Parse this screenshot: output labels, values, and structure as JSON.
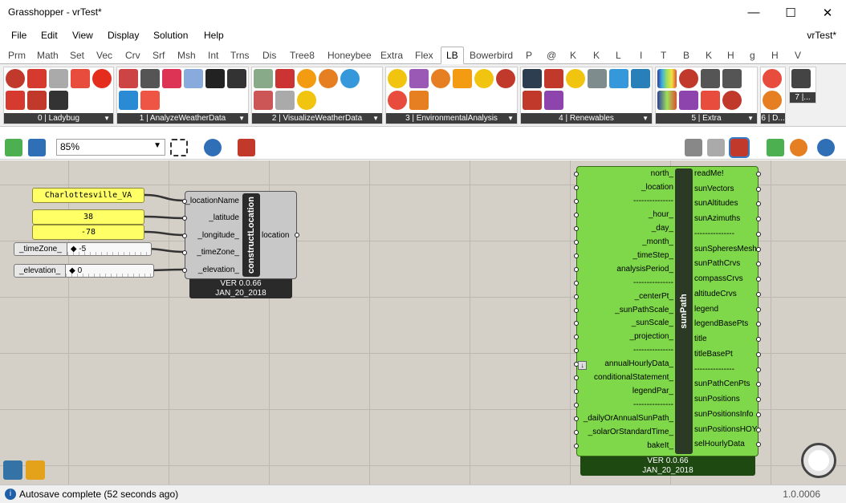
{
  "window": {
    "title": "Grasshopper - vrTest*",
    "doc_title": "vrTest*",
    "minimize": "—",
    "maximize": "☐",
    "close": "✕"
  },
  "menu": [
    "File",
    "Edit",
    "View",
    "Display",
    "Solution",
    "Help"
  ],
  "tabs": [
    "Prm",
    "Math",
    "Set",
    "Vec",
    "Crv",
    "Srf",
    "Msh",
    "Int",
    "Trns",
    "Dis",
    "Tree8",
    "Honeybee",
    "Extra",
    "Flex",
    "LB",
    "Bowerbird",
    "P",
    "@",
    "K",
    "K",
    "L",
    "I",
    "T",
    "B",
    "K",
    "H",
    "g",
    "H",
    "V"
  ],
  "active_tab": "LB",
  "ribbon_groups": [
    {
      "label": "0 | Ladybug"
    },
    {
      "label": "1 | AnalyzeWeatherData"
    },
    {
      "label": "2 | VisualizeWeatherData"
    },
    {
      "label": "3 | EnvironmentalAnalysis"
    },
    {
      "label": "4 | Renewables"
    },
    {
      "label": "5 | Extra"
    },
    {
      "label": "6 | D..."
    }
  ],
  "ribbon_extra_label": "7 |...",
  "canvas_toolbar": {
    "zoom": "85%"
  },
  "canvas": {
    "panels": {
      "location_name": "Charlottesville_VA",
      "latitude": "38",
      "longitude": "-78"
    },
    "sliders": {
      "timezone": {
        "label": "_timeZone_",
        "value": "-5"
      },
      "elevation": {
        "label": "_elevation_",
        "value": "0"
      }
    },
    "construct_location": {
      "name": "constructLocation",
      "inputs": [
        "_locationName",
        "_latitude",
        "_longitude_",
        "_timeZone_",
        "_elevation_"
      ],
      "output": "location",
      "version": "VER 0.0.66",
      "date": "JAN_20_2018"
    },
    "sunpath": {
      "name": "sunPath",
      "inputs": [
        "north_",
        "_location",
        "---------------",
        "_hour_",
        "_day_",
        "_month_",
        "_timeStep_",
        "analysisPeriod_",
        "---------------",
        "_centerPt_",
        "_sunPathScale_",
        "_sunScale_",
        "_projection_",
        "---------------",
        "annualHourlyData_",
        "conditionalStatement_",
        "legendPar_",
        "---------------",
        "_dailyOrAnnualSunPath_",
        "_solarOrStandardTime_",
        "bakeIt_"
      ],
      "outputs": [
        "readMe!",
        "sunVectors",
        "sunAltitudes",
        "sunAzimuths",
        "---------------",
        "sunSpheresMesh",
        "sunPathCrvs",
        "compassCrvs",
        "altitudeCrvs",
        "legend",
        "legendBasePts",
        "title",
        "titleBasePt",
        "---------------",
        "sunPathCenPts",
        "sunPositions",
        "sunPositionsInfo",
        "sunPositionsHOY",
        "selHourlyData"
      ],
      "version": "VER 0.0.66",
      "date": "JAN_20_2018"
    }
  },
  "status": {
    "message": "Autosave complete (52 seconds ago)",
    "version": "1.0.0006"
  }
}
